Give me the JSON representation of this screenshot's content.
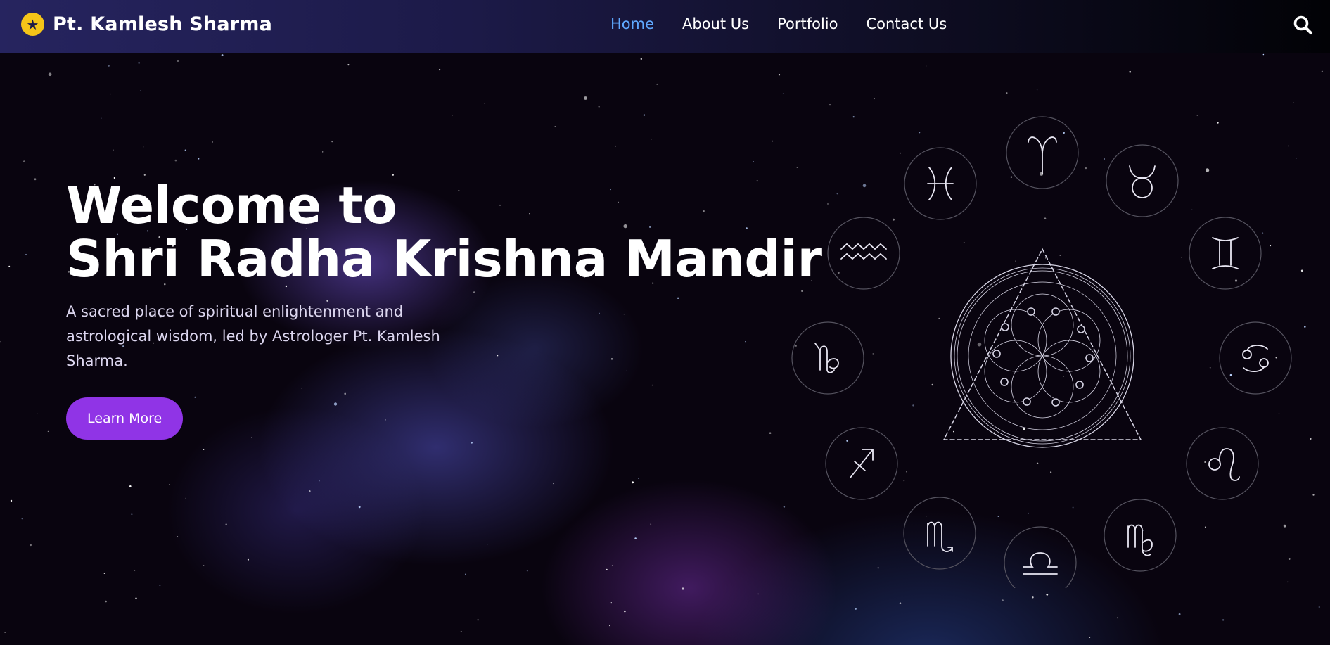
{
  "header": {
    "brand_name": "Pt. Kamlesh Sharma",
    "brand_icon": "star-badge-icon",
    "nav": [
      {
        "label": "Home",
        "active": true
      },
      {
        "label": "About Us",
        "active": false
      },
      {
        "label": "Portfolio",
        "active": false
      },
      {
        "label": "Contact Us",
        "active": false
      }
    ],
    "search_icon": "search-icon"
  },
  "hero": {
    "title_line1": "Welcome to",
    "title_line2": "Shri Radha Krishna Mandir",
    "subtitle": "A sacred place of spiritual enlightenment and astrological wisdom, led by Astrologer Pt. Kamlesh Sharma.",
    "cta_label": "Learn More"
  },
  "zodiac": {
    "signs": [
      "aries",
      "taurus",
      "gemini",
      "cancer",
      "leo",
      "virgo",
      "libra",
      "scorpio",
      "sagittarius",
      "capricorn",
      "aquarius",
      "pisces"
    ],
    "center_icon": "astrology-chart-icon"
  },
  "colors": {
    "accent": "#9034e6",
    "nav_active": "#5fa8ff",
    "brand_badge": "#f5c518",
    "header_bg_start": "#26245f",
    "background": "#07030d"
  }
}
